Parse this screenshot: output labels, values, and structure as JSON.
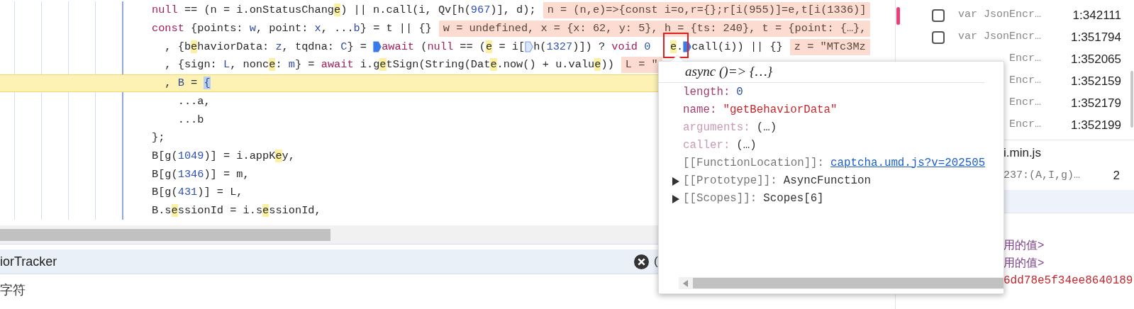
{
  "editor": {
    "lines": [
      {
        "current": false,
        "segments": [
          {
            "kind": "keyword",
            "text": "null"
          },
          {
            "kind": "plain",
            "text": " == (n = i.onStatusChang"
          },
          {
            "kind": "match",
            "text": "e"
          },
          {
            "kind": "plain",
            "text": ") || n.call(i, Qv[h("
          },
          {
            "kind": "number",
            "text": "967"
          },
          {
            "kind": "plain",
            "text": ")], d);"
          },
          {
            "kind": "inline_value",
            "text": "n = (n,e)=>{const i=o,r={};r[i(955)]=e,t[i(1336)]"
          }
        ]
      },
      {
        "current": false,
        "segments": [
          {
            "kind": "keyword",
            "text": "const"
          },
          {
            "kind": "plain",
            "text": " {points: "
          },
          {
            "kind": "def",
            "text": "w"
          },
          {
            "kind": "plain",
            "text": ", point: "
          },
          {
            "kind": "def",
            "text": "x"
          },
          {
            "kind": "plain",
            "text": ", ..."
          },
          {
            "kind": "def",
            "text": "b"
          },
          {
            "kind": "plain",
            "text": "} = t || {}"
          },
          {
            "kind": "inline_value",
            "text": "w = undefined, x = {x: 62, y: 5}, h = {ts: 240}, t = {point: {…},"
          }
        ]
      },
      {
        "current": false,
        "segments": [
          {
            "kind": "plain",
            "text": "  , {b"
          },
          {
            "kind": "match",
            "text": "e"
          },
          {
            "kind": "plain",
            "text": "haviorData: "
          },
          {
            "kind": "def",
            "text": "z"
          },
          {
            "kind": "plain",
            "text": ", tqdna: "
          },
          {
            "kind": "def",
            "text": "C"
          },
          {
            "kind": "plain",
            "text": "} = "
          },
          {
            "kind": "breakpoint",
            "active": true
          },
          {
            "kind": "keyword",
            "text": "await"
          },
          {
            "kind": "plain",
            "text": " ("
          },
          {
            "kind": "keyword",
            "text": "null"
          },
          {
            "kind": "plain",
            "text": " == ("
          },
          {
            "kind": "match",
            "text": "e"
          },
          {
            "kind": "plain",
            "text": " = i["
          },
          {
            "kind": "breakpoint",
            "active": false
          },
          {
            "kind": "plain",
            "text": "h("
          },
          {
            "kind": "number",
            "text": "1327"
          },
          {
            "kind": "plain",
            "text": ")]) ? "
          },
          {
            "kind": "keyword",
            "text": "void "
          },
          {
            "kind": "number",
            "text": "0   "
          },
          {
            "kind": "match",
            "text": "e"
          },
          {
            "kind": "plain",
            "text": "."
          },
          {
            "kind": "breakpoint",
            "active": true
          },
          {
            "kind": "plain",
            "text": "call(i)) || {}"
          },
          {
            "kind": "inline_value",
            "text": "z = \"MTc3Mz"
          }
        ]
      },
      {
        "current": false,
        "segments": [
          {
            "kind": "plain",
            "text": "  , {sign: "
          },
          {
            "kind": "def",
            "text": "L"
          },
          {
            "kind": "plain",
            "text": ", nonc"
          },
          {
            "kind": "match",
            "text": "e"
          },
          {
            "kind": "plain",
            "text": ": "
          },
          {
            "kind": "def",
            "text": "m"
          },
          {
            "kind": "plain",
            "text": "} = "
          },
          {
            "kind": "keyword",
            "text": "await"
          },
          {
            "kind": "plain",
            "text": " i.g"
          },
          {
            "kind": "match",
            "text": "e"
          },
          {
            "kind": "plain",
            "text": "tSign(String(Dat"
          },
          {
            "kind": "match",
            "text": "e"
          },
          {
            "kind": "plain",
            "text": ".now() + u.valu"
          },
          {
            "kind": "match",
            "text": "e"
          },
          {
            "kind": "plain",
            "text": "))"
          },
          {
            "kind": "inline_value",
            "text": "L = \""
          }
        ]
      },
      {
        "current": true,
        "segments": [
          {
            "kind": "plain",
            "text": "  , "
          },
          {
            "kind": "def",
            "text": "B"
          },
          {
            "kind": "plain",
            "text": " = "
          },
          {
            "kind": "bracket",
            "text": "{"
          }
        ]
      },
      {
        "current": false,
        "segments": [
          {
            "kind": "plain",
            "text": "    ...a,"
          }
        ]
      },
      {
        "current": false,
        "segments": [
          {
            "kind": "plain",
            "text": "    ...b"
          }
        ]
      },
      {
        "current": false,
        "segments": [
          {
            "kind": "plain",
            "text": "};"
          }
        ]
      },
      {
        "current": false,
        "segments": [
          {
            "kind": "plain",
            "text": "B[g("
          },
          {
            "kind": "number",
            "text": "1049"
          },
          {
            "kind": "plain",
            "text": ")] = i.appK"
          },
          {
            "kind": "match",
            "text": "e"
          },
          {
            "kind": "plain",
            "text": "y,"
          }
        ]
      },
      {
        "current": false,
        "segments": [
          {
            "kind": "plain",
            "text": "B[g("
          },
          {
            "kind": "number",
            "text": "1346"
          },
          {
            "kind": "plain",
            "text": ")] = m,"
          }
        ]
      },
      {
        "current": false,
        "segments": [
          {
            "kind": "plain",
            "text": "B[g("
          },
          {
            "kind": "number",
            "text": "431"
          },
          {
            "kind": "plain",
            "text": ")] = L,"
          }
        ]
      },
      {
        "current": false,
        "segments": [
          {
            "kind": "plain",
            "text": "B.s"
          },
          {
            "kind": "match",
            "text": "e"
          },
          {
            "kind": "plain",
            "text": "ssionId = i.s"
          },
          {
            "kind": "match",
            "text": "e"
          },
          {
            "kind": "plain",
            "text": "ssionId,"
          }
        ]
      }
    ]
  },
  "search_bar": {
    "value": "iorTracker",
    "result": "("
  },
  "status_text": "字符",
  "breakpoints": [
    {
      "label": "var JsonEncr…",
      "location": "1:342111",
      "checked": false,
      "paused": true
    },
    {
      "label": "var JsonEncr…",
      "location": "1:351794",
      "checked": false,
      "paused": false
    },
    {
      "label": "Encr…",
      "location": "1:352065",
      "paused": false
    },
    {
      "label": "Encr…",
      "location": "1:352159",
      "paused": false
    },
    {
      "label": "Encr…",
      "location": "1:352179",
      "paused": false
    },
    {
      "label": "Encr…",
      "location": "1:352199",
      "paused": false
    }
  ],
  "file_group": {
    "name": "i.min.js",
    "entry": "237:(A,I,g)…",
    "count": "2"
  },
  "scope_values": [
    {
      "text": "用的值>",
      "kind": "unavailable"
    },
    {
      "text": "用的值>",
      "kind": "unavailable"
    },
    {
      "text": "6dd78e5f34ee8640189",
      "kind": "string"
    }
  ],
  "popover": {
    "title": "async ()=> {…}",
    "properties": [
      {
        "key": "length:",
        "value": "0",
        "kind": "number",
        "dim": false,
        "internal": false,
        "expandable": false
      },
      {
        "key": "name:",
        "value": "\"getBehaviorData\"",
        "kind": "string",
        "dim": false,
        "internal": false,
        "expandable": false
      },
      {
        "key": "arguments:",
        "value": "(…)",
        "kind": "plain",
        "dim": true,
        "internal": false,
        "expandable": false
      },
      {
        "key": "caller:",
        "value": "(…)",
        "kind": "plain",
        "dim": true,
        "internal": false,
        "expandable": false
      },
      {
        "key": "[[FunctionLocation]]:",
        "value": "captcha.umd.js?v=202505",
        "kind": "link",
        "dim": false,
        "internal": true,
        "expandable": false
      },
      {
        "key": "[[Prototype]]:",
        "value": "AsyncFunction",
        "kind": "plain",
        "dim": false,
        "internal": true,
        "expandable": true
      },
      {
        "key": "[[Scopes]]:",
        "value": "Scopes[6]",
        "kind": "plain",
        "dim": false,
        "internal": true,
        "expandable": true
      }
    ]
  }
}
